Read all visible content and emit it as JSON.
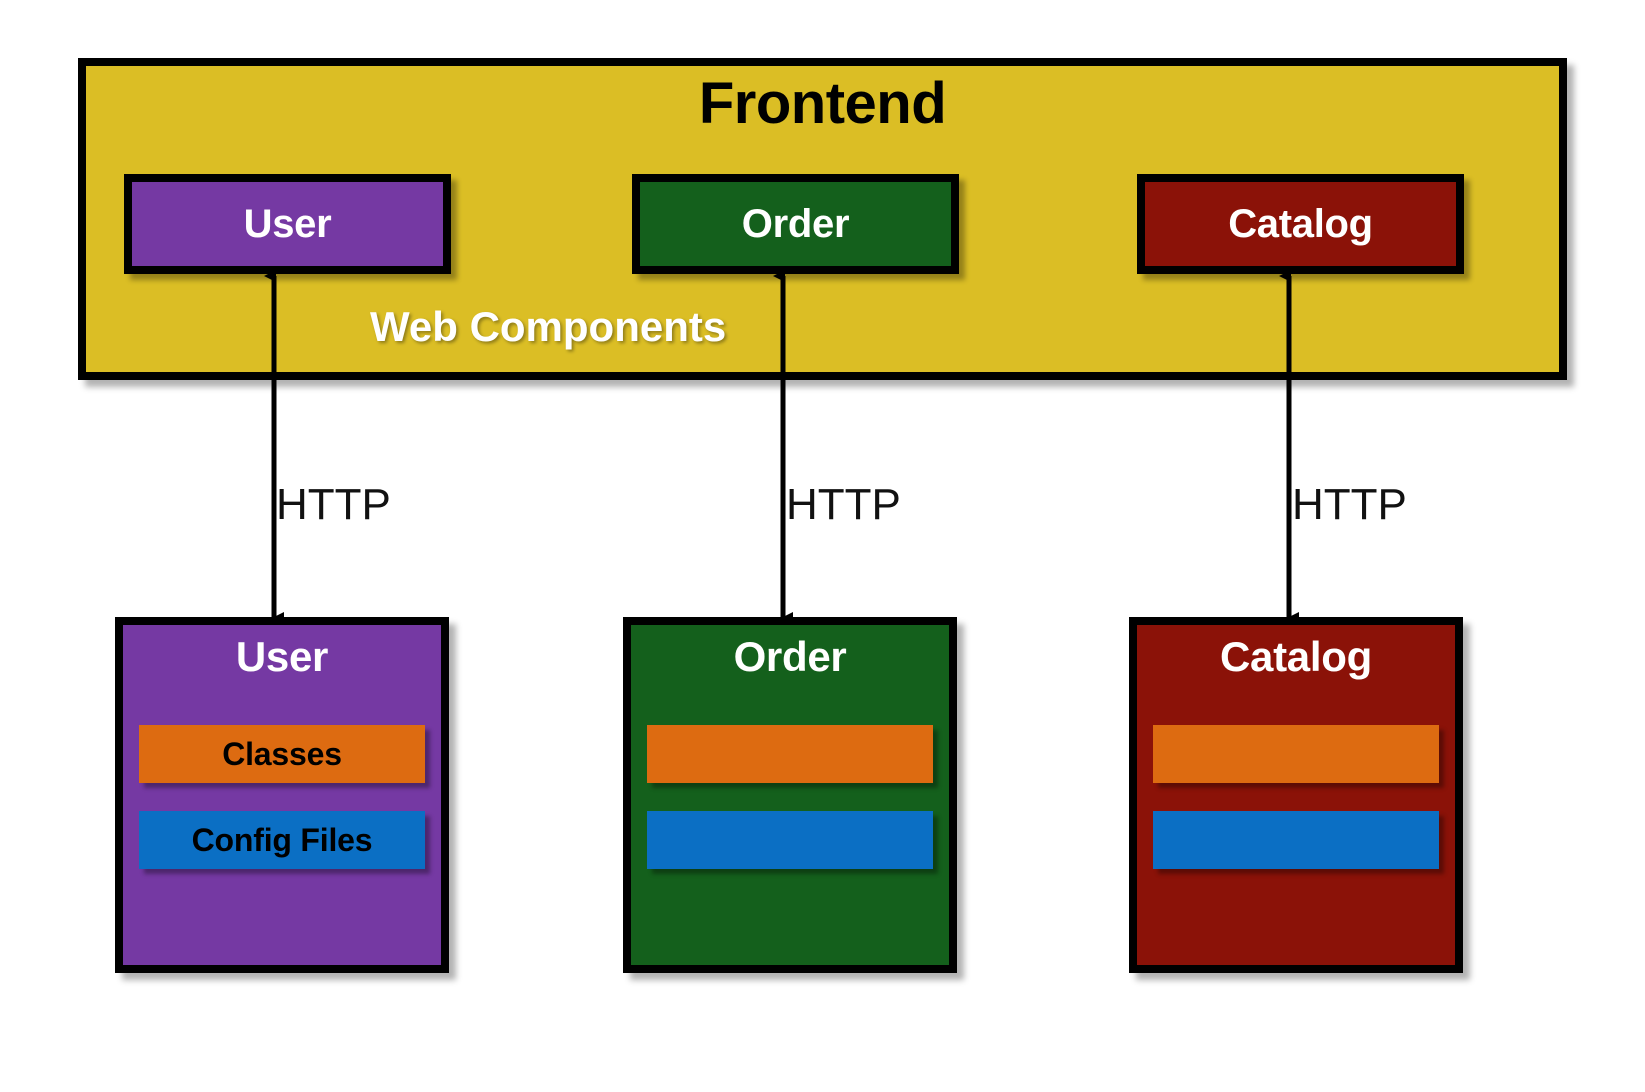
{
  "frontend": {
    "title": "Frontend",
    "sublabel": "Web Components",
    "background_color": "#DBBE25",
    "chips": [
      {
        "label": "User",
        "color": "#7539A3"
      },
      {
        "label": "Order",
        "color": "#14601C"
      },
      {
        "label": "Catalog",
        "color": "#8B1208"
      }
    ]
  },
  "connectors": [
    {
      "protocol": "HTTP",
      "from": "User",
      "to": "User",
      "direction": "bidirectional"
    },
    {
      "protocol": "HTTP",
      "from": "Order",
      "to": "Order",
      "direction": "bidirectional"
    },
    {
      "protocol": "HTTP",
      "from": "Catalog",
      "to": "Catalog",
      "direction": "bidirectional"
    }
  ],
  "services": [
    {
      "title": "User",
      "color": "#7539A3",
      "bars": [
        {
          "label": "Classes",
          "color": "#DD6B11"
        },
        {
          "label": "Config Files",
          "color": "#0B6FC4"
        }
      ]
    },
    {
      "title": "Order",
      "color": "#14601C",
      "bars": [
        {
          "label": "",
          "color": "#DD6B11"
        },
        {
          "label": "",
          "color": "#0B6FC4"
        }
      ]
    },
    {
      "title": "Catalog",
      "color": "#8B1208",
      "bars": [
        {
          "label": "",
          "color": "#DD6B11"
        },
        {
          "label": "",
          "color": "#0B6FC4"
        }
      ]
    }
  ],
  "palette": {
    "frontend_yellow": "#DBBE25",
    "user_purple": "#7539A3",
    "order_green": "#14601C",
    "catalog_red": "#8B1208",
    "bar_orange": "#DD6B11",
    "bar_blue": "#0B6FC4",
    "outline_black": "#000000",
    "canvas_white": "#FFFFFF"
  }
}
